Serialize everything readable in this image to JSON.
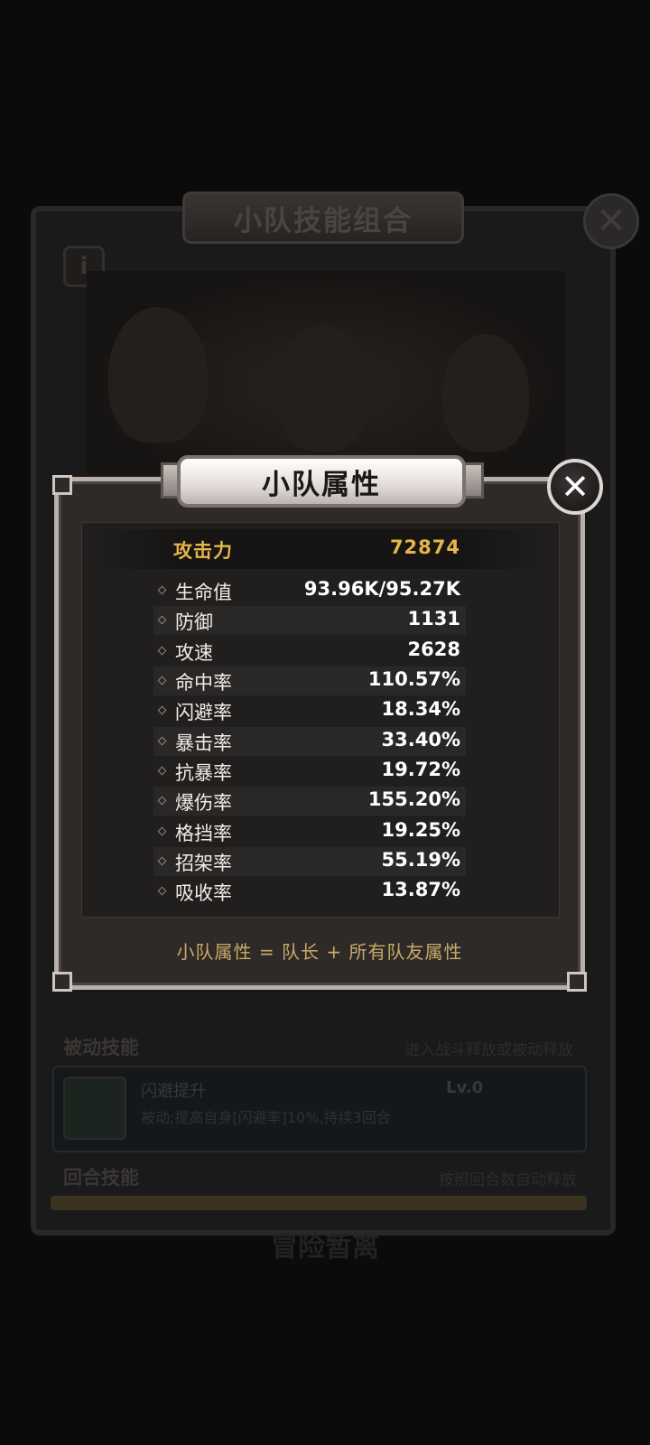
{
  "background": {
    "panel_title": "小队技能组合",
    "close_icon": "close-icon",
    "info_label": "i",
    "passive_section_label": "被动技能",
    "passive_section_hint": "进入战斗释放或被动释放",
    "skill_name": "闪避提升",
    "skill_level": "Lv.0",
    "skill_desc": "被动;提高自身[闪避率]10%,持续3回合",
    "round_section_label": "回合技能",
    "round_section_hint": "按照回合数自动释放",
    "bottom_button": "冒险暂离"
  },
  "dialog": {
    "title": "小队属性",
    "close_glyph": "✕",
    "attack": {
      "label": "攻击力",
      "value": "72874"
    },
    "stats": [
      {
        "label": "生命值",
        "value": "93.96K/95.27K"
      },
      {
        "label": "防御",
        "value": "1131"
      },
      {
        "label": "攻速",
        "value": "2628"
      },
      {
        "label": "命中率",
        "value": "110.57%"
      },
      {
        "label": "闪避率",
        "value": "18.34%"
      },
      {
        "label": "暴击率",
        "value": "33.40%"
      },
      {
        "label": "抗暴率",
        "value": "19.72%"
      },
      {
        "label": "爆伤率",
        "value": "155.20%"
      },
      {
        "label": "格挡率",
        "value": "19.25%"
      },
      {
        "label": "招架率",
        "value": "55.19%"
      },
      {
        "label": "吸收率",
        "value": "13.87%"
      }
    ],
    "formula": "小队属性 = 队长 + 所有队友属性"
  },
  "colors": {
    "accent_gold": "#e5b64a",
    "formula_gold": "#c9a96a",
    "panel": "#2e2a28",
    "frame": "#b8aeaa"
  }
}
